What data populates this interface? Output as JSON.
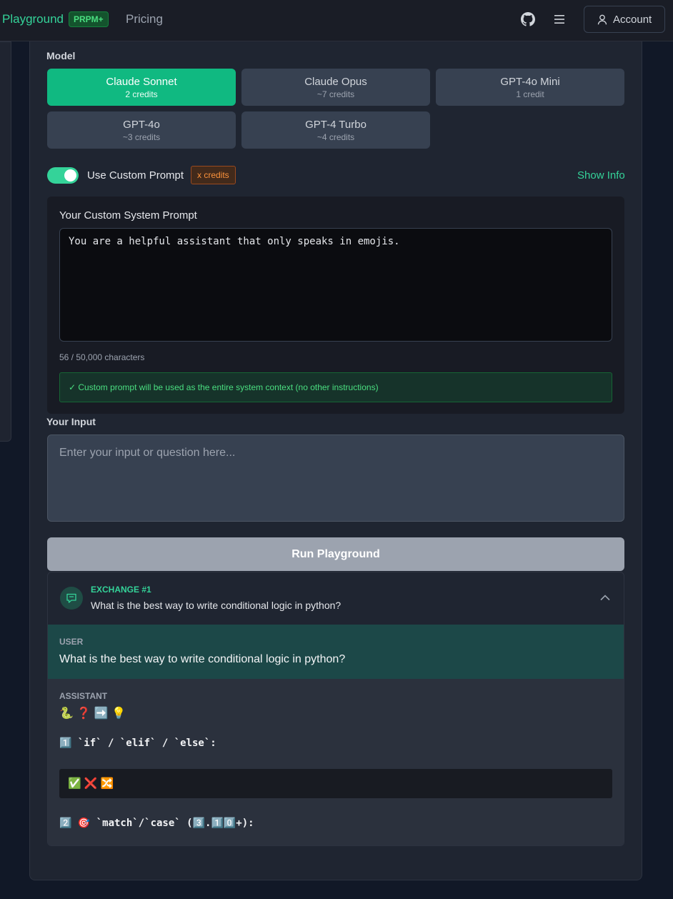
{
  "topbar": {
    "brand": "Playground",
    "brand_badge": "PRPM+",
    "nav_pricing": "Pricing",
    "account_label": "Account"
  },
  "model_section": {
    "label": "Model",
    "models": [
      {
        "name": "Claude Sonnet",
        "credits": "2 credits",
        "active": true
      },
      {
        "name": "Claude Opus",
        "credits": "~7 credits",
        "active": false
      },
      {
        "name": "GPT-4o Mini",
        "credits": "1 credit",
        "active": false
      },
      {
        "name": "GPT-4o",
        "credits": "~3 credits",
        "active": false
      },
      {
        "name": "GPT-4 Turbo",
        "credits": "~4 credits",
        "active": false
      }
    ]
  },
  "custom_prompt": {
    "toggle_label": "Use Custom Prompt",
    "toggle_on": true,
    "credits_badge": "x credits",
    "show_info": "Show Info",
    "title": "Your Custom System Prompt",
    "value": "You are a helpful assistant that only speaks in emojis.",
    "char_count": "56 / 50,000 characters",
    "note": "✓ Custom prompt will be used as the entire system context (no other instructions)"
  },
  "input_section": {
    "label": "Your Input",
    "placeholder": "Enter your input or question here..."
  },
  "run_button": "Run Playground",
  "exchange": {
    "label": "EXCHANGE #1",
    "question": "What is the best way to write conditional logic in python?",
    "user_role": "USER",
    "user_text": "What is the best way to write conditional logic in python?",
    "assistant_role": "ASSISTANT",
    "assistant_line1": "🐍 ❓ ➡️ 💡",
    "assistant_line2": "1️⃣ `if` / `elif` / `else`:",
    "assistant_code": "✅ ❌ 🔀",
    "assistant_line3": "2️⃣ 🎯 `match`/`case` (3️⃣.1️⃣0️⃣+):"
  },
  "colors": {
    "accent": "#10b981",
    "accent_text": "#34d399",
    "background": "#111827",
    "card": "#1f2531"
  }
}
